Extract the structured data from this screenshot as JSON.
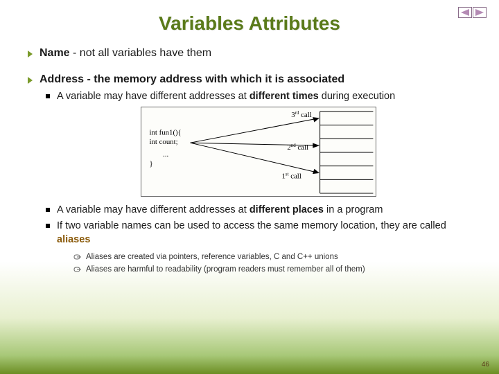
{
  "nav": {
    "prev": "prev",
    "next": "next"
  },
  "title": "Variables Attributes",
  "bullets": {
    "name_label": "Name",
    "name_rest": " - not all variables have them",
    "addr_label": "Address",
    "addr_rest": " - the memory address with which it is associated",
    "sub1_a": "A variable may have different addresses at ",
    "sub1_b": "different times",
    "sub1_c": " during execution",
    "sub2_a": "A variable may have different addresses at ",
    "sub2_b": "different places",
    "sub2_c": " in a program",
    "sub3_a": "If two variable names can be used to access the same memory location, they are called ",
    "sub3_b": "aliases",
    "tiny1": "Aliases are created via pointers, reference variables, C and C++ unions",
    "tiny2": "Aliases are harmful to readability (program readers must remember all of them)"
  },
  "diagram": {
    "code1": "int fun1(){",
    "code2": "int count;",
    "code3": "...",
    "code4": "}",
    "call1": "1",
    "call1_suffix": "st",
    "call1_word": " call",
    "call2": "2",
    "call2_suffix": "nd",
    "call2_word": " call",
    "call3": "3",
    "call3_suffix": "rd",
    "call3_word": " call"
  },
  "page": "46"
}
